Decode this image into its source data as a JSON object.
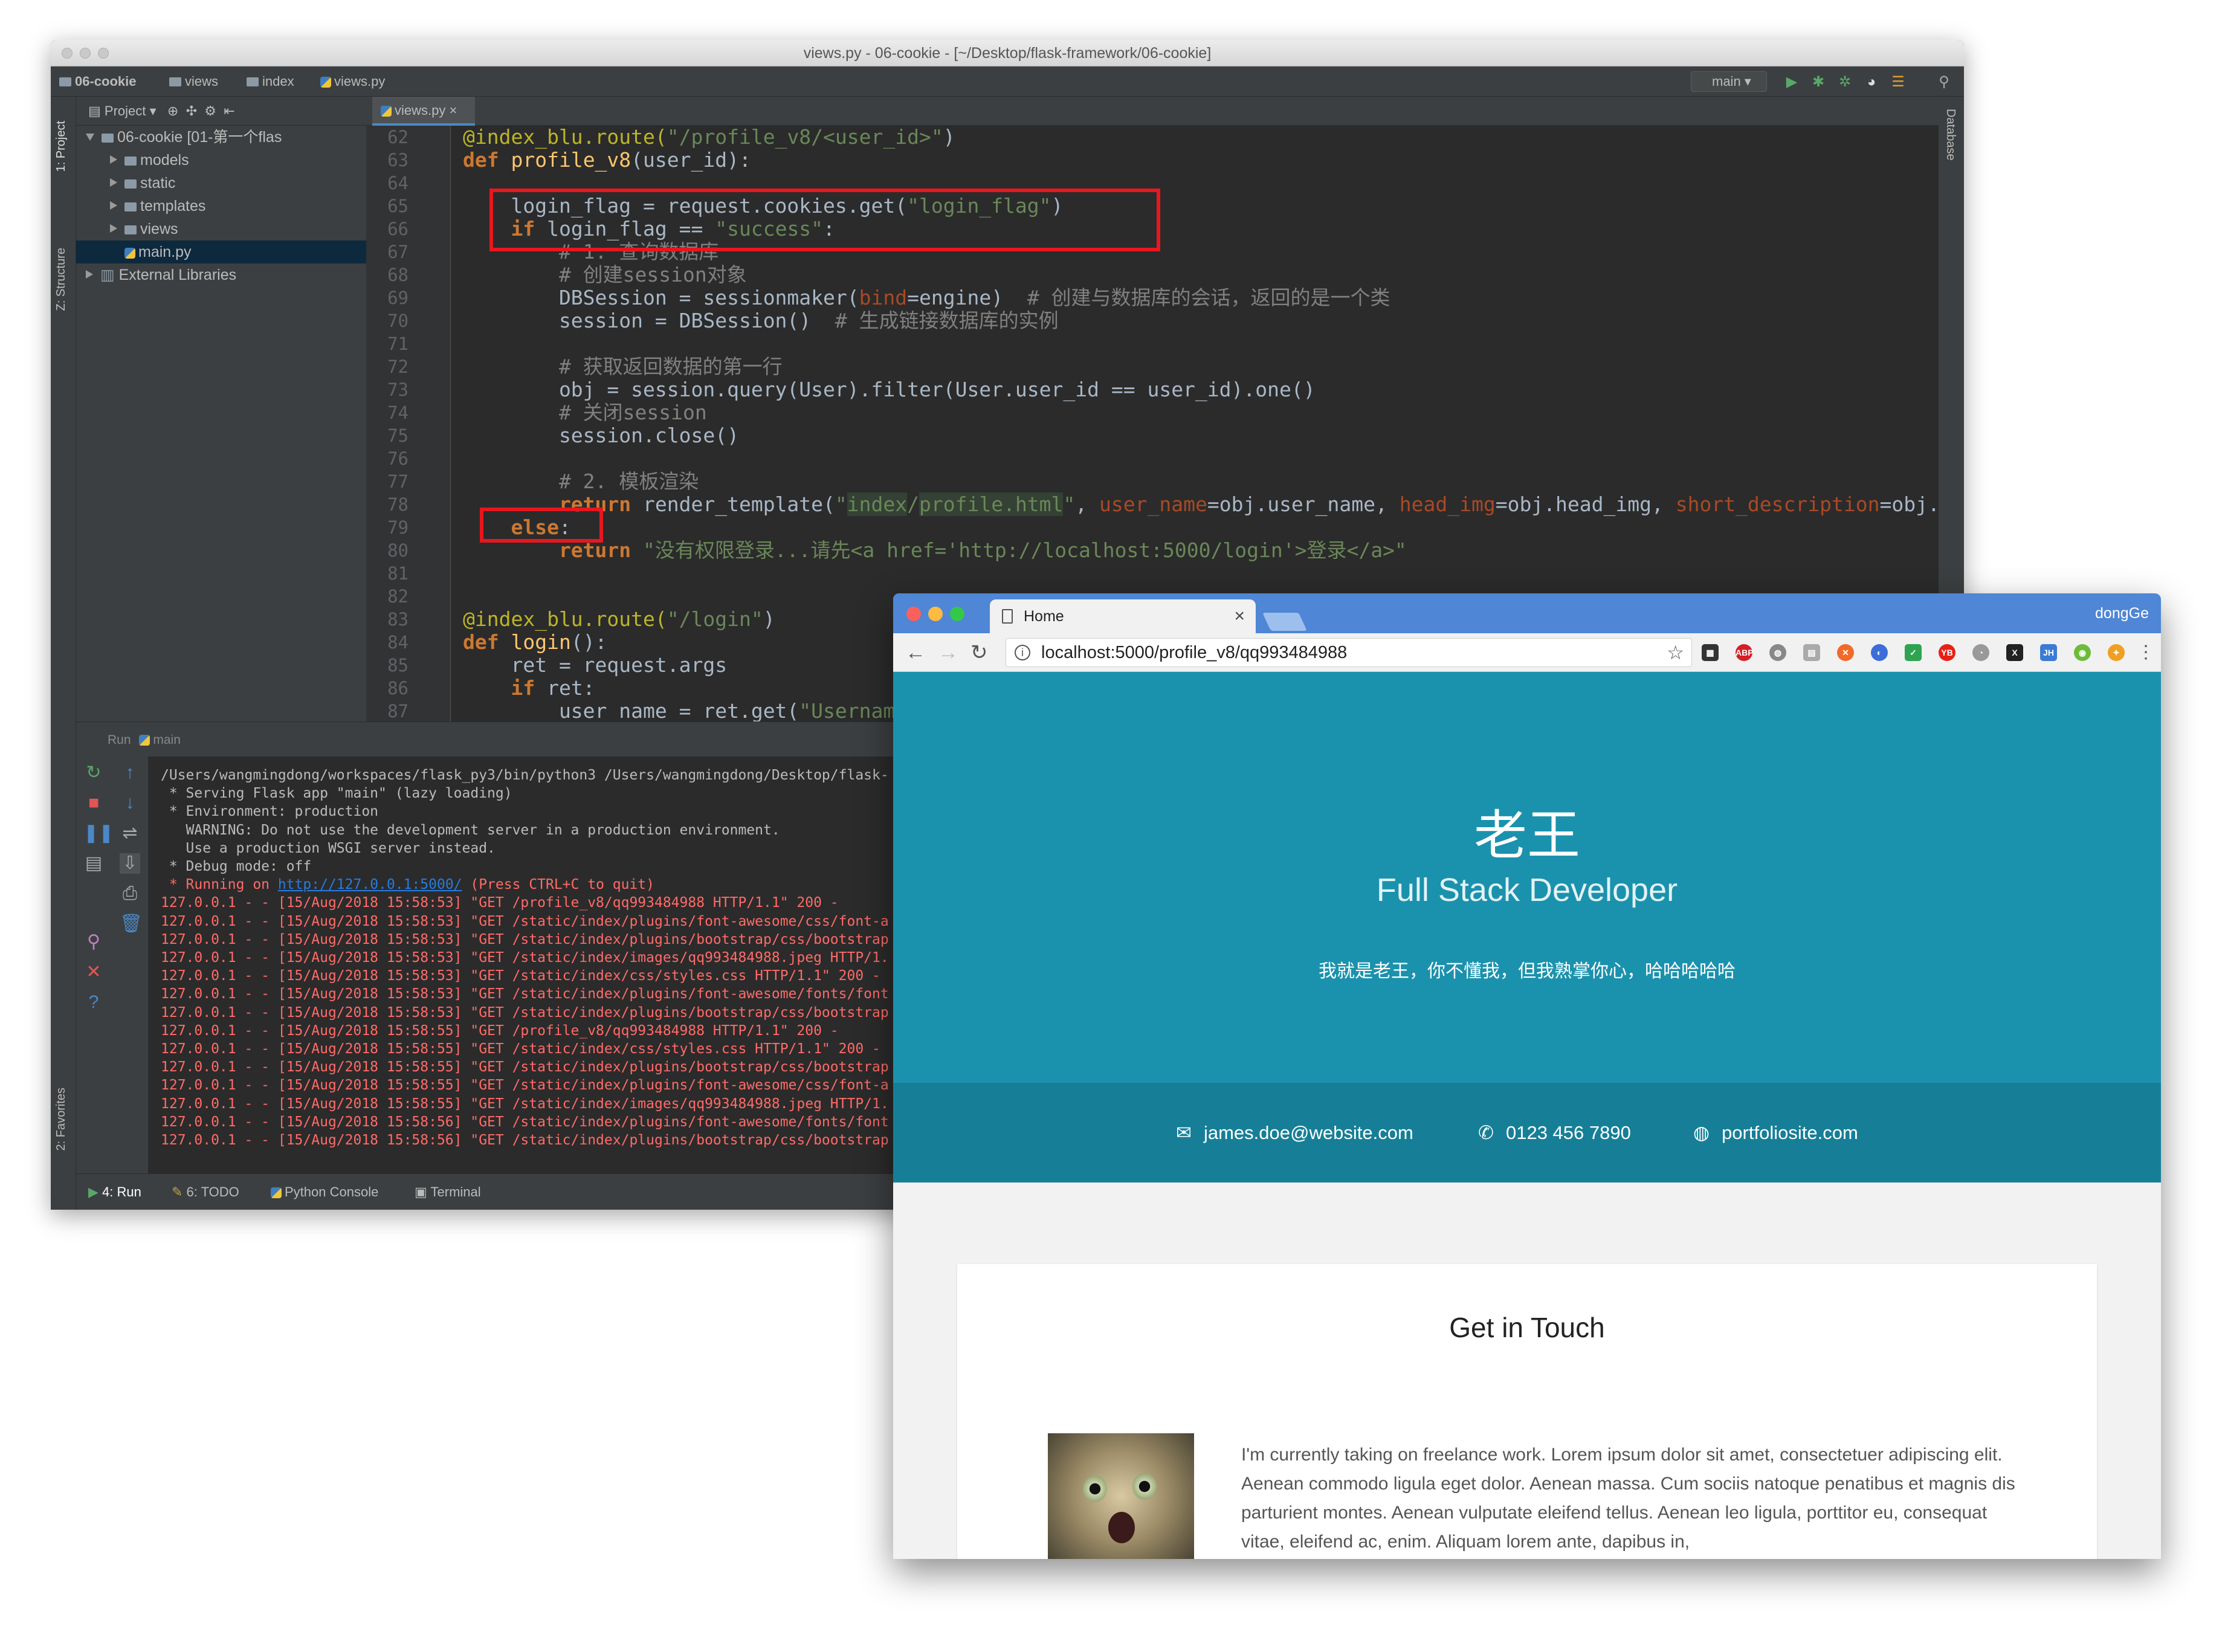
{
  "ide": {
    "window_title": "views.py - 06-cookie - [~/Desktop/flask-framework/06-cookie]",
    "breadcrumbs": [
      "06-cookie",
      "views",
      "index",
      "views.py"
    ],
    "run_config": "main",
    "left_strip": {
      "project": "1: Project",
      "structure": "Z: Structure",
      "favorites": "2: Favorites"
    },
    "right_strip": {
      "database": "Database"
    },
    "project_panel": {
      "header": "Project",
      "tree": [
        {
          "label": "06-cookie [01-第一个flas",
          "level": 0,
          "expanded": true,
          "kind": "folder"
        },
        {
          "label": "models",
          "level": 1,
          "expanded": false,
          "kind": "folder"
        },
        {
          "label": "static",
          "level": 1,
          "expanded": false,
          "kind": "folder"
        },
        {
          "label": "templates",
          "level": 1,
          "expanded": false,
          "kind": "folder"
        },
        {
          "label": "views",
          "level": 1,
          "expanded": false,
          "kind": "folder"
        },
        {
          "label": "main.py",
          "level": 2,
          "kind": "file",
          "selected": true
        },
        {
          "label": "External Libraries",
          "level": 0,
          "expanded": false,
          "kind": "lib"
        }
      ]
    },
    "editor_tab": "views.py",
    "code": {
      "line_numbers": [
        "62",
        "63",
        "64",
        "65",
        "66",
        "67",
        "68",
        "69",
        "70",
        "71",
        "72",
        "73",
        "74",
        "75",
        "76",
        "77",
        "78",
        "79",
        "80",
        "81",
        "82",
        "83",
        "84",
        "85",
        "86",
        "87"
      ],
      "l62": {
        "dec": "@index_blu.route(",
        "str": "\"/profile_v8/<user_id>\"",
        "end": ")"
      },
      "l63": {
        "kw": "def ",
        "fn": "profile_v8",
        "rest": "(user_id):"
      },
      "l65": {
        "a": "    login_flag = request.cookies.get(",
        "str": "\"login_flag\"",
        "b": ")"
      },
      "l66": {
        "kw": "    if ",
        "a": "login_flag == ",
        "str": "\"success\"",
        "b": ":"
      },
      "l67": "        # 1. 查询数据库",
      "l68": "        # 创建session对象",
      "l69": {
        "a": "        DBSession = sessionmaker(",
        "par": "bind",
        "b": "=engine)  ",
        "cm": "# 创建与数据库的会话，返回的是一个类"
      },
      "l70": {
        "a": "        session = DBSession()  ",
        "cm": "# 生成链接数据库的实例"
      },
      "l72": "        # 获取返回数据的第一行",
      "l73": "        obj = session.query(User).filter(User.user_id == user_id).one()",
      "l74": "        # 关闭session",
      "l75": "        session.close()",
      "l77": "        # 2. 模板渲染",
      "l78": {
        "kw": "        return ",
        "a": "render_template(",
        "q1": "\"",
        "hl1": "index",
        "s1": "/",
        "hl2": "profile.html",
        "q2": "\"",
        "c1": ", ",
        "p1": "user_name",
        "v1": "=obj.user_name, ",
        "p2": "head_img",
        "v2": "=obj.head_img, ",
        "p3": "short_description",
        "v3": "=obj.sho"
      },
      "l79": {
        "kw": "    else",
        "b": ":"
      },
      "l80": {
        "kw": "        return ",
        "str": "\"没有权限登录...请先<a href='http://localhost:5000/login'>登录</a>\""
      },
      "l83": {
        "dec": "@index_blu.route(",
        "str": "\"/login\"",
        "end": ")"
      },
      "l84": {
        "kw": "def ",
        "fn": "login",
        "rest": "():"
      },
      "l85": "    ret = request.args",
      "l86": {
        "kw": "    if ",
        "a": "ret:"
      },
      "l87": {
        "a": "        user_name = ret.get(",
        "str": "\"Username\"",
        "b": ")"
      }
    },
    "run_panel": {
      "title": "Run",
      "config": "main",
      "console": [
        {
          "t": "/Users/wangmingdong/workspaces/flask_py3/bin/python3 /Users/wangmingdong/Desktop/flask-",
          "c": "w"
        },
        {
          "t": " * Serving Flask app \"main\" (lazy loading)",
          "c": "w"
        },
        {
          "t": " * Environment: production",
          "c": "w"
        },
        {
          "t": "   WARNING: Do not use the development server in a production environment.",
          "c": "w"
        },
        {
          "t": "   Use a production WSGI server instead.",
          "c": "w"
        },
        {
          "t": " * Debug mode: off",
          "c": "w"
        }
      ],
      "running_prefix": " * Running on ",
      "running_link": "http://127.0.0.1:5000/",
      "running_suffix": " (Press CTRL+C to quit)",
      "log": [
        "127.0.0.1 - - [15/Aug/2018 15:58:53] \"GET /profile_v8/qq993484988 HTTP/1.1\" 200 -",
        "127.0.0.1 - - [15/Aug/2018 15:58:53] \"GET /static/index/plugins/font-awesome/css/font-a",
        "127.0.0.1 - - [15/Aug/2018 15:58:53] \"GET /static/index/plugins/bootstrap/css/bootstrap",
        "127.0.0.1 - - [15/Aug/2018 15:58:53] \"GET /static/index/images/qq993484988.jpeg HTTP/1.",
        "127.0.0.1 - - [15/Aug/2018 15:58:53] \"GET /static/index/css/styles.css HTTP/1.1\" 200 -",
        "127.0.0.1 - - [15/Aug/2018 15:58:53] \"GET /static/index/plugins/font-awesome/fonts/font",
        "127.0.0.1 - - [15/Aug/2018 15:58:53] \"GET /static/index/plugins/bootstrap/css/bootstrap",
        "127.0.0.1 - - [15/Aug/2018 15:58:55] \"GET /profile_v8/qq993484988 HTTP/1.1\" 200 -",
        "127.0.0.1 - - [15/Aug/2018 15:58:55] \"GET /static/index/css/styles.css HTTP/1.1\" 200 -",
        "127.0.0.1 - - [15/Aug/2018 15:58:55] \"GET /static/index/plugins/bootstrap/css/bootstrap",
        "127.0.0.1 - - [15/Aug/2018 15:58:55] \"GET /static/index/plugins/font-awesome/css/font-a",
        "127.0.0.1 - - [15/Aug/2018 15:58:55] \"GET /static/index/images/qq993484988.jpeg HTTP/1.",
        "127.0.0.1 - - [15/Aug/2018 15:58:56] \"GET /static/index/plugins/font-awesome/fonts/font",
        "127.0.0.1 - - [15/Aug/2018 15:58:56] \"GET /static/index/plugins/bootstrap/css/bootstrap"
      ]
    },
    "bottom_tabs": [
      "4: Run",
      "6: TODO",
      "Python Console",
      "Terminal"
    ]
  },
  "browser": {
    "tab_title": "Home",
    "user": "dongGe",
    "url": "localhost:5000/profile_v8/qq993484988",
    "hero": {
      "name": "老王",
      "title": "Full Stack Developer",
      "description": "我就是老王，你不懂我，但我熟掌你心，哈哈哈哈哈"
    },
    "contact": {
      "email": "james.doe@website.com",
      "phone": "0123 456 7890",
      "website": "portfoliosite.com"
    },
    "section_title": "Get in Touch",
    "bio": "I'm currently taking on freelance work. Lorem ipsum dolor sit amet, consectetuer adipiscing elit. Aenean commodo ligula eget dolor. Aenean massa. Cum sociis natoque penatibus et magnis dis parturient montes. Aenean vulputate eleifend tellus. Aenean leo ligula, porttitor eu, consequat vitae, eleifend ac, enim. Aliquam lorem ante, dapibus in,",
    "colors": {
      "hero": "#1b92ad",
      "contact_bar": "#167f97",
      "titlebar": "#4f86d6"
    }
  }
}
